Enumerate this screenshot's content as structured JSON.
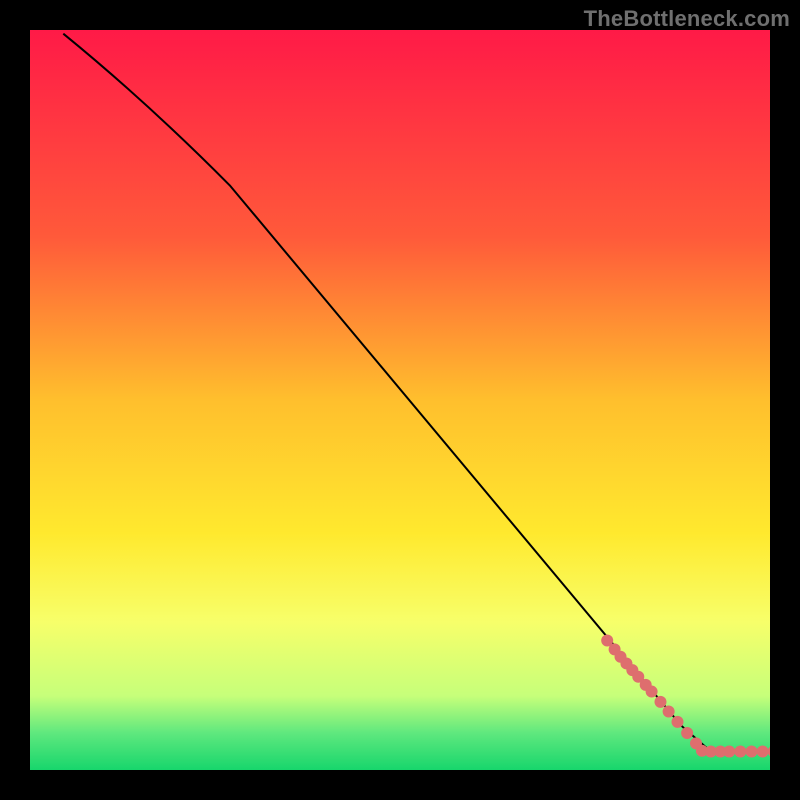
{
  "watermark": "TheBottleneck.com",
  "chart_data": {
    "type": "line",
    "title": "",
    "xlabel": "",
    "ylabel": "",
    "xlim": [
      0,
      100
    ],
    "ylim": [
      0,
      100
    ],
    "grid": false,
    "legend": false,
    "gradient_stops": [
      {
        "offset": 0,
        "color": "#ff1a47"
      },
      {
        "offset": 28,
        "color": "#ff5a3a"
      },
      {
        "offset": 50,
        "color": "#ffbf2d"
      },
      {
        "offset": 68,
        "color": "#ffe92e"
      },
      {
        "offset": 80,
        "color": "#f7ff6a"
      },
      {
        "offset": 90,
        "color": "#c6ff7a"
      },
      {
        "offset": 95,
        "color": "#5fe87e"
      },
      {
        "offset": 100,
        "color": "#17d66c"
      }
    ],
    "series": [
      {
        "name": "curve",
        "stroke": "#000000",
        "points": [
          {
            "x": 4.5,
            "y": 99.5
          },
          {
            "x": 27.0,
            "y": 79.0
          },
          {
            "x": 88.0,
            "y": 6.0
          },
          {
            "x": 92.0,
            "y": 2.5
          },
          {
            "x": 100.0,
            "y": 2.5
          }
        ]
      }
    ],
    "scatter": {
      "name": "dots",
      "color": "#de6e6e",
      "radius": 6,
      "points": [
        {
          "x": 78.0,
          "y": 17.5
        },
        {
          "x": 79.0,
          "y": 16.3
        },
        {
          "x": 79.8,
          "y": 15.3
        },
        {
          "x": 80.6,
          "y": 14.4
        },
        {
          "x": 81.4,
          "y": 13.5
        },
        {
          "x": 82.2,
          "y": 12.6
        },
        {
          "x": 83.2,
          "y": 11.5
        },
        {
          "x": 84.0,
          "y": 10.6
        },
        {
          "x": 85.2,
          "y": 9.2
        },
        {
          "x": 86.3,
          "y": 7.9
        },
        {
          "x": 87.5,
          "y": 6.5
        },
        {
          "x": 88.8,
          "y": 5.0
        },
        {
          "x": 90.0,
          "y": 3.6
        },
        {
          "x": 90.8,
          "y": 2.6
        },
        {
          "x": 92.0,
          "y": 2.5
        },
        {
          "x": 93.3,
          "y": 2.5
        },
        {
          "x": 94.5,
          "y": 2.5
        },
        {
          "x": 96.0,
          "y": 2.5
        },
        {
          "x": 97.5,
          "y": 2.5
        },
        {
          "x": 99.0,
          "y": 2.5
        },
        {
          "x": 100.5,
          "y": 2.5
        }
      ]
    }
  }
}
